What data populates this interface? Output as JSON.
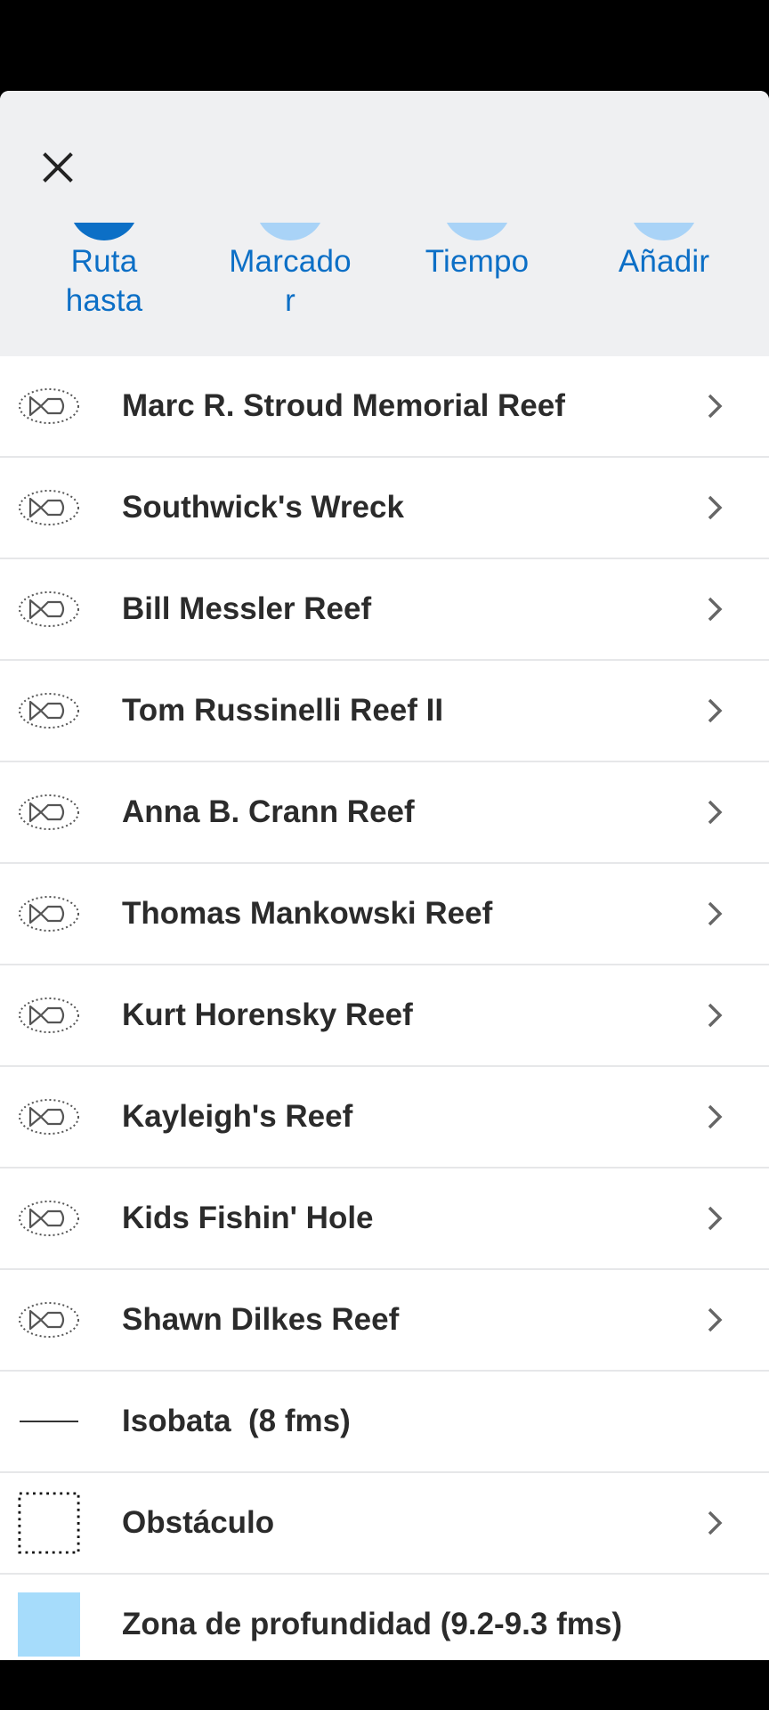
{
  "header": {
    "actions": [
      {
        "label": "Ruta\nhasta",
        "icon": "route-icon",
        "color": "#0c6fc6"
      },
      {
        "label": "Marcado\nr",
        "icon": "marker-icon",
        "color": "#a9d3f7"
      },
      {
        "label": "Tiempo",
        "icon": "weather-icon",
        "color": "#a9d3f7"
      },
      {
        "label": "Añadir",
        "icon": "add-icon",
        "color": "#a9d3f7"
      }
    ]
  },
  "items": [
    {
      "name": "Marc R. Stroud Memorial Reef",
      "icon": "fish-haven-icon",
      "chevron": true
    },
    {
      "name": "Southwick's Wreck",
      "icon": "fish-haven-icon",
      "chevron": true
    },
    {
      "name": "Bill Messler Reef",
      "icon": "fish-haven-icon",
      "chevron": true
    },
    {
      "name": "Tom Russinelli Reef II",
      "icon": "fish-haven-icon",
      "chevron": true
    },
    {
      "name": "Anna B. Crann Reef",
      "icon": "fish-haven-icon",
      "chevron": true
    },
    {
      "name": "Thomas Mankowski Reef",
      "icon": "fish-haven-icon",
      "chevron": true
    },
    {
      "name": "Kurt Horensky Reef",
      "icon": "fish-haven-icon",
      "chevron": true
    },
    {
      "name": "Kayleigh's Reef",
      "icon": "fish-haven-icon",
      "chevron": true
    },
    {
      "name": "Kids Fishin' Hole",
      "icon": "fish-haven-icon",
      "chevron": true
    },
    {
      "name": "Shawn Dilkes Reef",
      "icon": "fish-haven-icon",
      "chevron": true
    },
    {
      "name": "Isobata  (8 fms)",
      "icon": "depth-contour-line-icon",
      "chevron": false
    },
    {
      "name": "Obstáculo",
      "icon": "obstruction-icon",
      "chevron": true
    },
    {
      "name": "Zona de profundidad (9.2-9.3 fms)",
      "icon": "depth-area-swatch-icon",
      "chevron": false
    }
  ],
  "colors": {
    "accent": "#0c6fc6",
    "header_bg": "#eff0f2",
    "depth_area": "#a6dcfb"
  }
}
